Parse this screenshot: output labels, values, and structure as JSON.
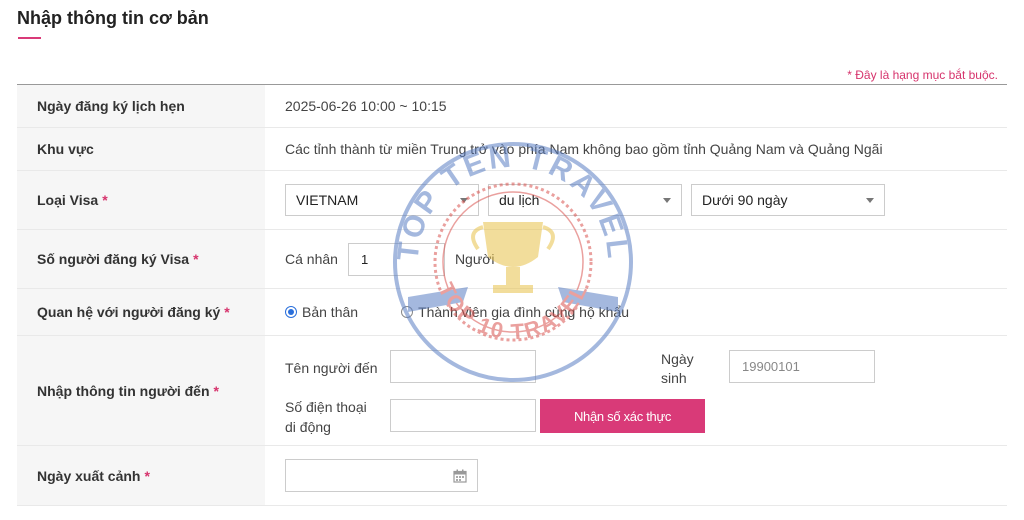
{
  "page_title": "Nhập thông tin cơ bản",
  "required_note": "* Đây là hạng mục bắt buộc.",
  "rows": {
    "appointment": {
      "label": "Ngày đăng ký lịch hẹn",
      "value": "2025-06-26 10:00 ~ 10:15"
    },
    "region": {
      "label": "Khu vực",
      "value": "Các tỉnh thành từ miền Trung trở vào phía Nam không bao gồm tỉnh Quảng Nam và Quảng Ngãi"
    },
    "visa_type": {
      "label": "Loại Visa",
      "required": "*",
      "nationality": "VIETNAM",
      "purpose": "du lịch",
      "duration": "Dưới 90 ngày"
    },
    "applicants": {
      "label": "Số người đăng ký Visa",
      "required": "*",
      "prefix": "Cá nhân",
      "count": "1",
      "suffix": "Người"
    },
    "relationship": {
      "label": "Quan hệ với người đăng ký",
      "required": "*",
      "options": [
        {
          "label": "Bản thân",
          "checked": true
        },
        {
          "label": "Thành viên gia đình cùng hộ khẩu",
          "checked": false
        }
      ]
    },
    "visitor_info": {
      "label": "Nhập thông tin người đến",
      "required": "*",
      "name_label": "Tên người đến",
      "name_value": "",
      "dob_label_1": "Ngày",
      "dob_label_2": "sinh",
      "dob_placeholder": "19900101",
      "phone_label_1": "Số điện thoại",
      "phone_label_2": "di động",
      "phone_value": "",
      "verify_button": "Nhận số xác thực"
    },
    "departure": {
      "label": "Ngày xuất cảnh",
      "required": "*",
      "value": ""
    }
  },
  "watermark": {
    "text_top": "TOP TEN TRAVEL",
    "text_bottom": "TOP 10 TRAVEL",
    "color_blue": "#5b7fc4",
    "color_red": "#d9534f",
    "color_gold": "#e8c24a"
  },
  "colors": {
    "accent": "#d93a78",
    "required": "#d6336c",
    "radio": "#2a6fdb"
  }
}
